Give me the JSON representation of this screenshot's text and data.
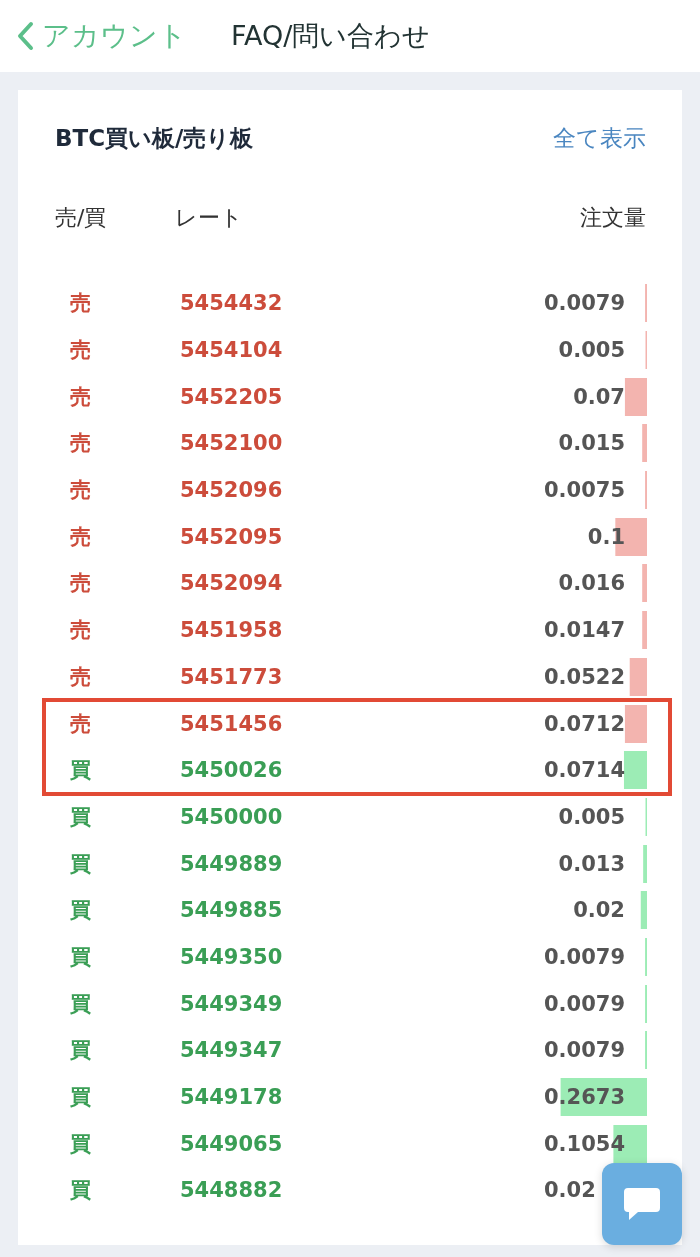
{
  "nav": {
    "back_label": "アカウント",
    "title": "FAQ/問い合わせ"
  },
  "order_book": {
    "title": "BTC買い板/売り板",
    "show_all": "全て表示",
    "columns": [
      "売/買",
      "レート",
      "注文量"
    ],
    "rows": [
      {
        "kind": "sell",
        "side": "売",
        "rate": "5454432",
        "amount": "0.0079",
        "level": 0.02,
        "highlighted": false
      },
      {
        "kind": "sell",
        "side": "売",
        "rate": "5454104",
        "amount": "0.005",
        "level": 0.015,
        "highlighted": false
      },
      {
        "kind": "sell",
        "side": "売",
        "rate": "5452205",
        "amount": "0.07",
        "level": 0.23,
        "highlighted": false
      },
      {
        "kind": "sell",
        "side": "売",
        "rate": "5452100",
        "amount": "0.015",
        "level": 0.05,
        "highlighted": false
      },
      {
        "kind": "sell",
        "side": "売",
        "rate": "5452096",
        "amount": "0.0075",
        "level": 0.02,
        "highlighted": false
      },
      {
        "kind": "sell",
        "side": "売",
        "rate": "5452095",
        "amount": "0.1",
        "level": 0.33,
        "highlighted": false
      },
      {
        "kind": "sell",
        "side": "売",
        "rate": "5452094",
        "amount": "0.016",
        "level": 0.05,
        "highlighted": false
      },
      {
        "kind": "sell",
        "side": "売",
        "rate": "5451958",
        "amount": "0.0147",
        "level": 0.05,
        "highlighted": false
      },
      {
        "kind": "sell",
        "side": "売",
        "rate": "5451773",
        "amount": "0.0522",
        "level": 0.18,
        "highlighted": false
      },
      {
        "kind": "sell",
        "side": "売",
        "rate": "5451456",
        "amount": "0.0712",
        "level": 0.23,
        "highlighted": true
      },
      {
        "kind": "buy",
        "side": "買",
        "rate": "5450026",
        "amount": "0.0714",
        "level": 0.24,
        "highlighted": true
      },
      {
        "kind": "buy",
        "side": "買",
        "rate": "5450000",
        "amount": "0.005",
        "level": 0.015,
        "highlighted": false
      },
      {
        "kind": "buy",
        "side": "買",
        "rate": "5449889",
        "amount": "0.013",
        "level": 0.04,
        "highlighted": false
      },
      {
        "kind": "buy",
        "side": "買",
        "rate": "5449885",
        "amount": "0.02",
        "level": 0.065,
        "highlighted": false
      },
      {
        "kind": "buy",
        "side": "買",
        "rate": "5449350",
        "amount": "0.0079",
        "level": 0.02,
        "highlighted": false
      },
      {
        "kind": "buy",
        "side": "買",
        "rate": "5449349",
        "amount": "0.0079",
        "level": 0.02,
        "highlighted": false
      },
      {
        "kind": "buy",
        "side": "買",
        "rate": "5449347",
        "amount": "0.0079",
        "level": 0.02,
        "highlighted": false
      },
      {
        "kind": "buy",
        "side": "買",
        "rate": "5449178",
        "amount": "0.2673",
        "level": 0.9,
        "highlighted": false
      },
      {
        "kind": "buy",
        "side": "買",
        "rate": "5449065",
        "amount": "0.1054",
        "level": 0.35,
        "highlighted": false
      },
      {
        "kind": "buy",
        "side": "買",
        "rate": "5448882",
        "amount": "0.02",
        "covered": true,
        "highlighted": false
      }
    ]
  }
}
